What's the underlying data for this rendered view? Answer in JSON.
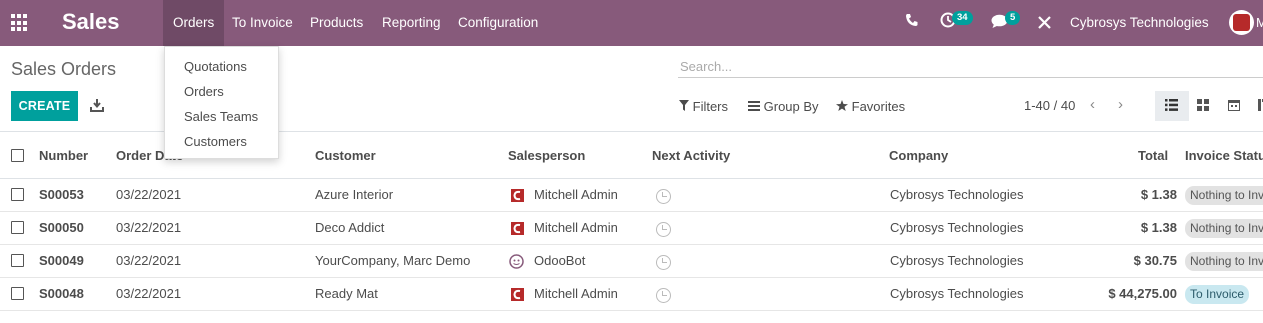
{
  "navbar": {
    "app_name": "Sales",
    "menu": [
      "Orders",
      "To Invoice",
      "Products",
      "Reporting",
      "Configuration"
    ],
    "active_menu": "Orders",
    "activity_count": "34",
    "messages_count": "5",
    "company": "Cybrosys Technologies",
    "user_initial": "M",
    "bg_color": "#875a7b"
  },
  "orders_dropdown": [
    "Quotations",
    "Orders",
    "Sales Teams",
    "Customers"
  ],
  "control_panel": {
    "breadcrumb": "Sales Orders",
    "search_placeholder": "Search...",
    "create_label": "CREATE",
    "filters_label": "Filters",
    "group_by_label": "Group By",
    "favorites_label": "Favorites",
    "pager": "1-40 / 40",
    "accent_color": "#00a09d"
  },
  "table": {
    "columns": [
      "Number",
      "Order Date",
      "Customer",
      "Salesperson",
      "Next Activity",
      "Company",
      "Total",
      "Invoice Status"
    ],
    "rows": [
      {
        "number": "S00053",
        "date": "03/22/2021",
        "customer": "Azure Interior",
        "salesperson": "Mitchell Admin",
        "company": "Cybrosys Technologies",
        "total": "$ 1.38",
        "status": "Nothing to Invoice"
      },
      {
        "number": "S00050",
        "date": "03/22/2021",
        "customer": "Deco Addict",
        "salesperson": "Mitchell Admin",
        "company": "Cybrosys Technologies",
        "total": "$ 1.38",
        "status": "Nothing to Invoice"
      },
      {
        "number": "S00049",
        "date": "03/22/2021",
        "customer": "YourCompany, Marc Demo",
        "salesperson": "OdooBot",
        "company": "Cybrosys Technologies",
        "total": "$ 30.75",
        "status": "Nothing to Invoice"
      },
      {
        "number": "S00048",
        "date": "03/22/2021",
        "customer": "Ready Mat",
        "salesperson": "Mitchell Admin",
        "company": "Cybrosys Technologies",
        "total": "$ 44,275.00",
        "status": "To Invoice"
      }
    ]
  }
}
